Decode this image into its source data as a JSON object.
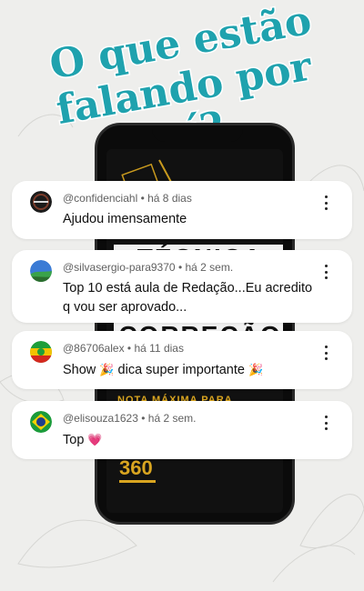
{
  "headline": {
    "line1": "O que estão",
    "line2": "falando por",
    "line3": "aí?",
    "fill_color": "#1fa2ae",
    "outline_color": "#ffffff"
  },
  "phone_poster": {
    "line1": "TÉCNICA DE",
    "line2": "CORREÇÃO E",
    "subline": "NOTA MÁXIMA PARA",
    "logo": "360",
    "accent_color": "#d9a520"
  },
  "comments": [
    {
      "author": "@confidenciahl",
      "time": "há 8 dias",
      "text": "Ajudou imensamente",
      "avatar_icon": "dark-logo-avatar"
    },
    {
      "author": "@silvasergio-para9370",
      "time": "há 2 sem.",
      "text": "Top 10 está aula de Redação...Eu acredito q vou ser aprovado...",
      "avatar_icon": "blue-landscape-avatar"
    },
    {
      "author": "@86706alex",
      "time": "há 11 dias",
      "text_before": "Show",
      "text_middle": "dica super importante",
      "emoji": "🎉",
      "avatar_icon": "green-yellow-flag-avatar"
    },
    {
      "author": "@elisouza1623",
      "time": "há 2 sem.",
      "text": "Top",
      "emoji": "💗",
      "avatar_icon": "brazil-flag-avatar"
    }
  ],
  "meta_separator": "•",
  "more_icon": "kebab-menu-icon"
}
